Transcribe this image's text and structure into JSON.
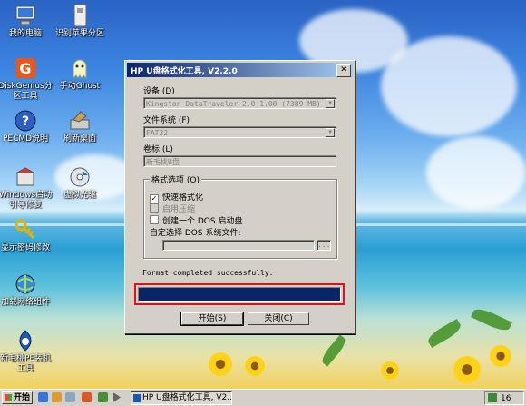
{
  "desktop_icons": [
    {
      "label": "我的电脑",
      "icon": "computer-icon"
    },
    {
      "label": "识别苹果分区",
      "icon": "drive-icon"
    },
    {
      "label": "DiskGenius分区工具",
      "icon": "diskgenius-icon"
    },
    {
      "label": "手动Ghost",
      "icon": "ghost-icon"
    },
    {
      "label": "PECMD说明",
      "icon": "help-icon"
    },
    {
      "label": "刷新桌面",
      "icon": "refresh-icon"
    },
    {
      "label": "Windows启动引导修复",
      "icon": "repair-icon"
    },
    {
      "label": "虚拟光驱",
      "icon": "virtual-drive-icon"
    },
    {
      "label": "显示密码修改",
      "icon": "key-icon"
    },
    {
      "label": "加载网络组件",
      "icon": "network-icon"
    },
    {
      "label": "新毛桃PE装机工具",
      "icon": "installer-icon"
    }
  ],
  "dialog": {
    "title": "HP U盘格式化工具, V2.2.0",
    "close_glyph": "✕",
    "device_label": "设备 (D)",
    "device_value": "Kingston DataTraveler 2.0 1.00 (7389 MB) (G:",
    "filesystem_label": "文件系统 (F)",
    "filesystem_value": "FAT32",
    "volume_label": "卷标 (L)",
    "volume_value": "新毛桃U盘",
    "options_title": "格式选项 (O)",
    "quick_format": "快速格式化",
    "compression": "启用压缩",
    "create_dos": "创建一个 DOS 启动盘",
    "dos_files": "自定选择 DOS 系统文件:",
    "browse_label": "...",
    "status": "Format completed successfully.",
    "progress": 1.0,
    "start_button": "开始(S)",
    "close_button": "关闭(C)"
  },
  "taskbar": {
    "start_label": "开始",
    "window_button": "HP U盘格式化工具, V2....",
    "tray_text": "16"
  },
  "colors": {
    "title_active": "#0a246a",
    "progress_fill": "#0a246a",
    "highlight_box": "#d8131b"
  }
}
